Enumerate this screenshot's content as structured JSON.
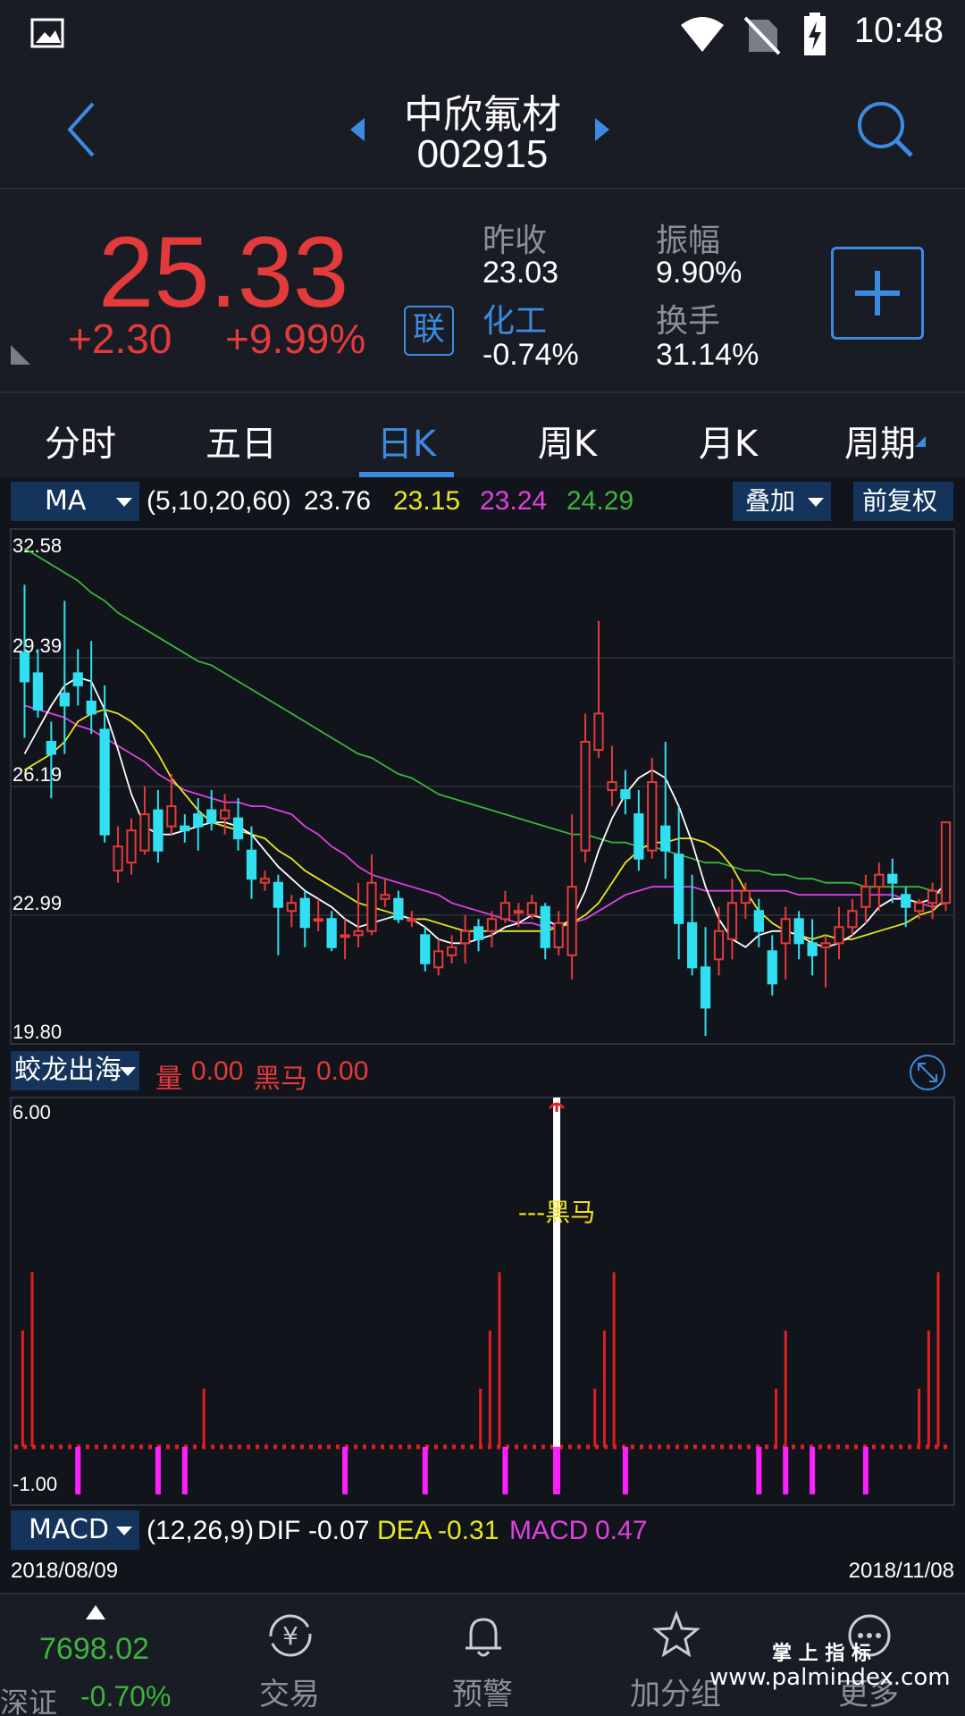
{
  "status": {
    "time": "10:48"
  },
  "header": {
    "stock_name": "中欣氟材",
    "stock_code": "002915"
  },
  "quote": {
    "price": "25.33",
    "change": "+2.30",
    "change_pct": "+9.99%",
    "badge": "联",
    "prev_close_label": "昨收",
    "prev_close": "23.03",
    "sector_label": "化工",
    "sector_change": "-0.74%",
    "amplitude_label": "振幅",
    "amplitude": "9.90%",
    "turnover_label": "换手",
    "turnover": "31.14%"
  },
  "tabs": [
    {
      "label": "分时"
    },
    {
      "label": "五日"
    },
    {
      "label": "日K"
    },
    {
      "label": "周K"
    },
    {
      "label": "月K"
    },
    {
      "label": "周期"
    }
  ],
  "ma_bar": {
    "selector": "MA",
    "params": "(5,10,20,60)",
    "ma5": "23.76",
    "ma10": "23.15",
    "ma20": "23.24",
    "ma60": "24.29",
    "overlay_label": "叠加",
    "adjust_label": "前复权"
  },
  "colors": {
    "up": "#e33b3b",
    "down": "#30e0f0",
    "ma5": "#ffffff",
    "ma10": "#e8e820",
    "ma20": "#e040e0",
    "ma60": "#3cb43c",
    "accent": "#3d8be0"
  },
  "chart_data": [
    {
      "type": "candlestick",
      "y_ticks": [
        "32.58",
        "29.39",
        "26.19",
        "22.99",
        "19.80"
      ],
      "ylim": [
        19.8,
        32.58
      ],
      "x_start": "2018/08/09",
      "x_end": "2018/11/08",
      "candles": [
        [
          29.5,
          28.8,
          31.2,
          27.4
        ],
        [
          29.0,
          28.1,
          29.6,
          27.9
        ],
        [
          27.3,
          27.0,
          27.8,
          25.9
        ],
        [
          28.5,
          28.2,
          30.8,
          27.0
        ],
        [
          29.0,
          28.7,
          29.6,
          28.2
        ],
        [
          28.3,
          28.0,
          29.8,
          27.5
        ],
        [
          27.6,
          25.0,
          28.7,
          24.8
        ],
        [
          24.1,
          24.7,
          25.2,
          23.8
        ],
        [
          24.3,
          25.1,
          25.4,
          24.0
        ],
        [
          24.6,
          25.5,
          26.2,
          24.5
        ],
        [
          25.6,
          24.6,
          26.1,
          24.3
        ],
        [
          25.2,
          25.7,
          26.5,
          25.0
        ],
        [
          25.2,
          25.1,
          25.5,
          24.8
        ],
        [
          25.5,
          25.2,
          25.9,
          24.6
        ],
        [
          25.6,
          25.3,
          26.1,
          25.1
        ],
        [
          25.4,
          25.6,
          26.0,
          25.0
        ],
        [
          25.4,
          24.9,
          25.9,
          24.6
        ],
        [
          24.6,
          23.9,
          25.2,
          23.4
        ],
        [
          23.8,
          23.9,
          24.1,
          23.6
        ],
        [
          23.8,
          23.2,
          24.0,
          22.0
        ],
        [
          23.1,
          23.3,
          23.5,
          22.7
        ],
        [
          23.4,
          22.7,
          23.6,
          22.2
        ],
        [
          22.9,
          22.9,
          23.4,
          22.6
        ],
        [
          22.9,
          22.2,
          23.1,
          22.1
        ],
        [
          22.5,
          22.5,
          22.9,
          21.9
        ],
        [
          22.5,
          22.6,
          23.8,
          22.2
        ],
        [
          22.6,
          23.8,
          24.5,
          22.5
        ],
        [
          23.4,
          23.5,
          23.9,
          23.2
        ],
        [
          23.4,
          22.9,
          23.6,
          22.8
        ],
        [
          22.9,
          22.9,
          23.1,
          22.7
        ],
        [
          22.5,
          21.8,
          22.7,
          21.6
        ],
        [
          21.7,
          22.1,
          22.4,
          21.5
        ],
        [
          22.0,
          22.2,
          22.5,
          21.8
        ],
        [
          22.3,
          22.6,
          23.0,
          21.8
        ],
        [
          22.7,
          22.4,
          22.9,
          22.1
        ],
        [
          22.6,
          22.9,
          23.1,
          22.2
        ],
        [
          22.9,
          23.3,
          23.6,
          22.8
        ],
        [
          23.1,
          23.1,
          23.3,
          22.7
        ],
        [
          23.0,
          23.3,
          23.5,
          22.9
        ],
        [
          23.2,
          22.2,
          23.3,
          21.9
        ],
        [
          22.2,
          22.8,
          23.1,
          22.0
        ],
        [
          22.0,
          23.7,
          25.5,
          21.4
        ],
        [
          24.6,
          27.3,
          28.0,
          24.3
        ],
        [
          27.1,
          28.0,
          30.3,
          26.9
        ],
        [
          26.1,
          26.3,
          27.2,
          25.7
        ],
        [
          26.1,
          25.9,
          26.6,
          25.5
        ],
        [
          25.5,
          24.4,
          26.1,
          24.1
        ],
        [
          24.6,
          26.3,
          26.9,
          24.4
        ],
        [
          25.2,
          24.6,
          27.3,
          23.9
        ],
        [
          24.5,
          22.8,
          25.7,
          21.9
        ],
        [
          22.8,
          21.7,
          24.0,
          21.5
        ],
        [
          21.7,
          20.7,
          22.7,
          20.0
        ],
        [
          21.9,
          22.6,
          23.2,
          21.5
        ],
        [
          22.4,
          23.3,
          23.9,
          21.9
        ],
        [
          23.3,
          23.6,
          23.8,
          22.9
        ],
        [
          23.1,
          22.6,
          23.4,
          22.2
        ],
        [
          22.1,
          21.3,
          22.5,
          21.0
        ],
        [
          22.3,
          22.9,
          23.2,
          21.4
        ],
        [
          22.9,
          22.3,
          23.1,
          21.9
        ],
        [
          22.3,
          22.0,
          22.9,
          21.5
        ],
        [
          22.2,
          22.3,
          22.5,
          21.2
        ],
        [
          22.3,
          22.7,
          23.2,
          21.9
        ],
        [
          22.7,
          23.1,
          23.4,
          22.5
        ],
        [
          23.2,
          23.7,
          24.0,
          22.8
        ],
        [
          23.7,
          24.0,
          24.3,
          23.1
        ],
        [
          24.0,
          23.8,
          24.4,
          23.3
        ],
        [
          23.5,
          23.2,
          23.7,
          22.7
        ],
        [
          23.1,
          23.3,
          23.4,
          22.9
        ],
        [
          23.3,
          23.6,
          23.8,
          22.9
        ],
        [
          23.3,
          25.3,
          25.3,
          23.1
        ]
      ],
      "ma5": [
        27.0,
        27.6,
        28.2,
        28.7,
        28.9,
        28.8,
        28.1,
        27.1,
        26.0,
        25.2,
        25.0,
        25.0,
        25.1,
        25.2,
        25.3,
        25.3,
        25.2,
        25.0,
        24.6,
        24.2,
        23.9,
        23.6,
        23.4,
        23.2,
        22.9,
        22.7,
        22.8,
        22.9,
        23.0,
        22.9,
        22.7,
        22.4,
        22.3,
        22.3,
        22.4,
        22.5,
        22.7,
        22.8,
        23.0,
        22.9,
        22.7,
        22.9,
        23.6,
        24.6,
        25.4,
        26.0,
        26.4,
        26.6,
        26.4,
        25.7,
        24.8,
        23.7,
        22.9,
        22.4,
        22.2,
        22.5,
        22.6,
        22.6,
        22.5,
        22.3,
        22.2,
        22.3,
        22.5,
        22.8,
        23.2,
        23.4,
        23.4,
        23.3,
        23.4,
        23.8
      ],
      "ma10": [
        26.6,
        26.8,
        27.0,
        27.3,
        27.8,
        28.0,
        28.1,
        28.0,
        27.8,
        27.5,
        27.0,
        26.4,
        26.0,
        25.6,
        25.3,
        25.2,
        25.1,
        25.0,
        24.9,
        24.6,
        24.4,
        24.1,
        23.9,
        23.7,
        23.5,
        23.3,
        23.2,
        23.1,
        23.0,
        22.9,
        22.9,
        22.8,
        22.7,
        22.6,
        22.6,
        22.6,
        22.6,
        22.6,
        22.6,
        22.6,
        22.7,
        22.8,
        23.0,
        23.3,
        23.8,
        24.3,
        24.6,
        24.8,
        24.8,
        24.9,
        24.9,
        24.8,
        24.6,
        24.2,
        23.6,
        23.1,
        22.8,
        22.6,
        22.5,
        22.4,
        22.5,
        22.4,
        22.4,
        22.5,
        22.6,
        22.7,
        22.8,
        23.0,
        23.1,
        23.4
      ],
      "ma20": [
        28.2,
        28.1,
        28.0,
        27.9,
        27.7,
        27.6,
        27.4,
        27.2,
        27.0,
        26.8,
        26.5,
        26.3,
        26.1,
        26.0,
        25.9,
        25.8,
        25.8,
        25.7,
        25.7,
        25.6,
        25.5,
        25.2,
        25.0,
        24.7,
        24.5,
        24.2,
        24.0,
        23.9,
        23.8,
        23.7,
        23.6,
        23.5,
        23.3,
        23.2,
        23.1,
        23.0,
        22.9,
        22.8,
        22.8,
        22.7,
        22.7,
        22.8,
        22.9,
        23.1,
        23.3,
        23.5,
        23.6,
        23.7,
        23.7,
        23.7,
        23.7,
        23.6,
        23.6,
        23.6,
        23.6,
        23.6,
        23.6,
        23.6,
        23.5,
        23.5,
        23.5,
        23.5,
        23.5,
        23.5,
        23.5,
        23.5,
        23.4,
        23.3,
        23.2,
        23.3
      ],
      "ma60": [
        32.1,
        31.9,
        31.7,
        31.5,
        31.3,
        31.0,
        30.8,
        30.5,
        30.3,
        30.1,
        29.9,
        29.7,
        29.5,
        29.3,
        29.2,
        29.0,
        28.8,
        28.6,
        28.4,
        28.2,
        28.0,
        27.8,
        27.6,
        27.4,
        27.2,
        27.0,
        26.9,
        26.7,
        26.5,
        26.4,
        26.2,
        26.0,
        25.9,
        25.8,
        25.7,
        25.6,
        25.5,
        25.4,
        25.3,
        25.2,
        25.1,
        25.0,
        25.0,
        24.9,
        24.8,
        24.8,
        24.7,
        24.7,
        24.6,
        24.5,
        24.4,
        24.3,
        24.3,
        24.2,
        24.1,
        24.1,
        24.0,
        24.0,
        23.9,
        23.9,
        23.8,
        23.8,
        23.8,
        23.7,
        23.7,
        23.7,
        23.7,
        23.7,
        23.6,
        23.5
      ]
    },
    {
      "type": "bar",
      "selector": "蛟龙出海",
      "legend": {
        "vol_label": "量",
        "vol_value": "0.00",
        "dark_label": "黑马",
        "dark_value": "0.00"
      },
      "y_ticks": [
        "6.00",
        "-1.00"
      ],
      "ylim": [
        -1.0,
        6.0
      ],
      "annotation": "---黑马",
      "values": [
        2.0,
        3.0,
        0,
        0,
        0,
        0,
        0,
        0,
        0,
        0,
        0,
        0,
        0,
        0,
        0,
        0,
        0,
        0,
        0,
        1.0,
        0,
        0,
        0,
        0,
        0,
        0,
        0,
        0,
        0,
        0,
        0,
        0,
        0,
        0,
        0,
        0,
        0,
        0,
        0,
        0,
        0,
        0,
        0,
        0,
        0,
        0,
        0,
        0,
        1.0,
        2.0,
        3.0,
        0,
        0,
        0,
        0,
        0,
        6.0,
        0,
        0,
        0,
        1.0,
        2.0,
        3.0,
        0,
        0,
        0,
        0,
        0,
        0,
        0,
        0,
        0,
        0,
        0,
        0,
        0,
        0,
        0,
        0,
        1.0,
        2.0,
        0,
        0,
        0,
        0,
        0,
        0,
        0,
        0,
        0,
        0,
        0,
        0,
        0,
        1.0,
        2.0,
        3.0,
        0
      ],
      "magenta_markers": [
        4,
        10,
        12,
        24,
        30,
        36,
        45,
        55,
        57,
        59,
        63
      ]
    }
  ],
  "macd_bar": {
    "selector": "MACD",
    "params": "(12,26,9)",
    "dif_label": "DIF",
    "dif": "-0.07",
    "dea_label": "DEA",
    "dea": "-0.31",
    "macd_label": "MACD",
    "macd": "0.47"
  },
  "dates": {
    "start": "2018/08/09",
    "end": "2018/11/08"
  },
  "bottom_nav": {
    "index_value": "7698.02",
    "index_name": "深证",
    "index_change": "-0.70%",
    "items": [
      {
        "label": "交易"
      },
      {
        "label": "预警"
      },
      {
        "label": "加分组"
      },
      {
        "label": "更多"
      }
    ],
    "watermark_top": "掌 上 指 标",
    "watermark_bottom": "www.palmindex.com"
  }
}
